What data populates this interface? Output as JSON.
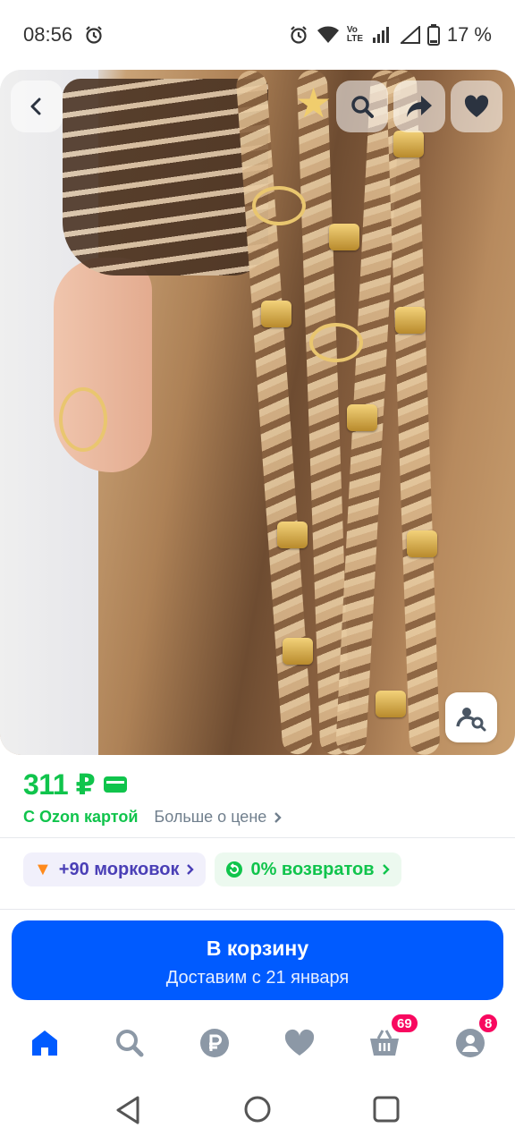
{
  "status_bar": {
    "time": "08:56",
    "battery": "17 %",
    "network_label": "Vo LTE"
  },
  "product_image": {
    "description_icons": [
      "back-icon",
      "search-icon",
      "share-icon",
      "heart-icon",
      "image-search-icon"
    ]
  },
  "price": {
    "value": "311 ₽",
    "with_card": "С Ozon картой",
    "more_link": "Больше о цене"
  },
  "chips": {
    "carrots": "+90 морковок",
    "returns": "0% возвратов"
  },
  "cart_button": {
    "title": "В корзину",
    "subtitle": "Доставим с 21 января"
  },
  "tab_bar": {
    "items": [
      "home",
      "search",
      "payments",
      "favorites",
      "cart",
      "profile"
    ],
    "cart_badge": "69",
    "profile_badge": "8"
  },
  "colors": {
    "accent_blue": "#005bff",
    "price_green": "#10c44c",
    "badge_pink": "#f8085f",
    "carrot_purple": "#4a3fb6"
  }
}
